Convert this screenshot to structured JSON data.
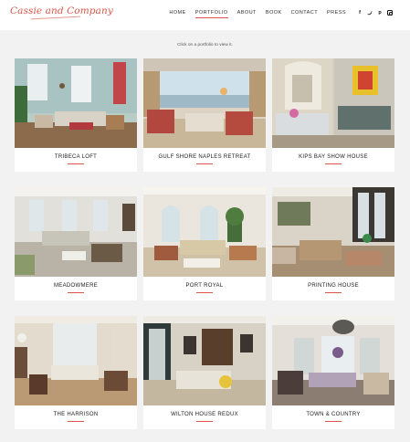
{
  "header": {
    "logo": "Cassie and Company",
    "nav": [
      {
        "label": "HOME",
        "active": false
      },
      {
        "label": "PORTFOLIO",
        "active": true
      },
      {
        "label": "ABOUT",
        "active": false
      },
      {
        "label": "BOOK",
        "active": false
      },
      {
        "label": "CONTACT",
        "active": false
      },
      {
        "label": "PRESS",
        "active": false
      }
    ],
    "social": [
      "facebook-icon",
      "twitter-icon",
      "pinterest-icon",
      "instagram-icon"
    ]
  },
  "instruction": "Click on a portfolio to view it.",
  "portfolios": [
    {
      "title": "TRIBECA LOFT"
    },
    {
      "title": "GULF SHORE NAPLES RETREAT"
    },
    {
      "title": "KIPS BAY SHOW HOUSE"
    },
    {
      "title": "MEADOWMERE"
    },
    {
      "title": "PORT ROYAL"
    },
    {
      "title": "PRINTING HOUSE"
    },
    {
      "title": "THE HARRISON"
    },
    {
      "title": "WILTON HOUSE REDUX"
    },
    {
      "title": "TOWN & COUNTRY"
    }
  ],
  "colors": {
    "accent": "#d8574a",
    "background": "#f2f2f2",
    "card": "#ffffff"
  }
}
